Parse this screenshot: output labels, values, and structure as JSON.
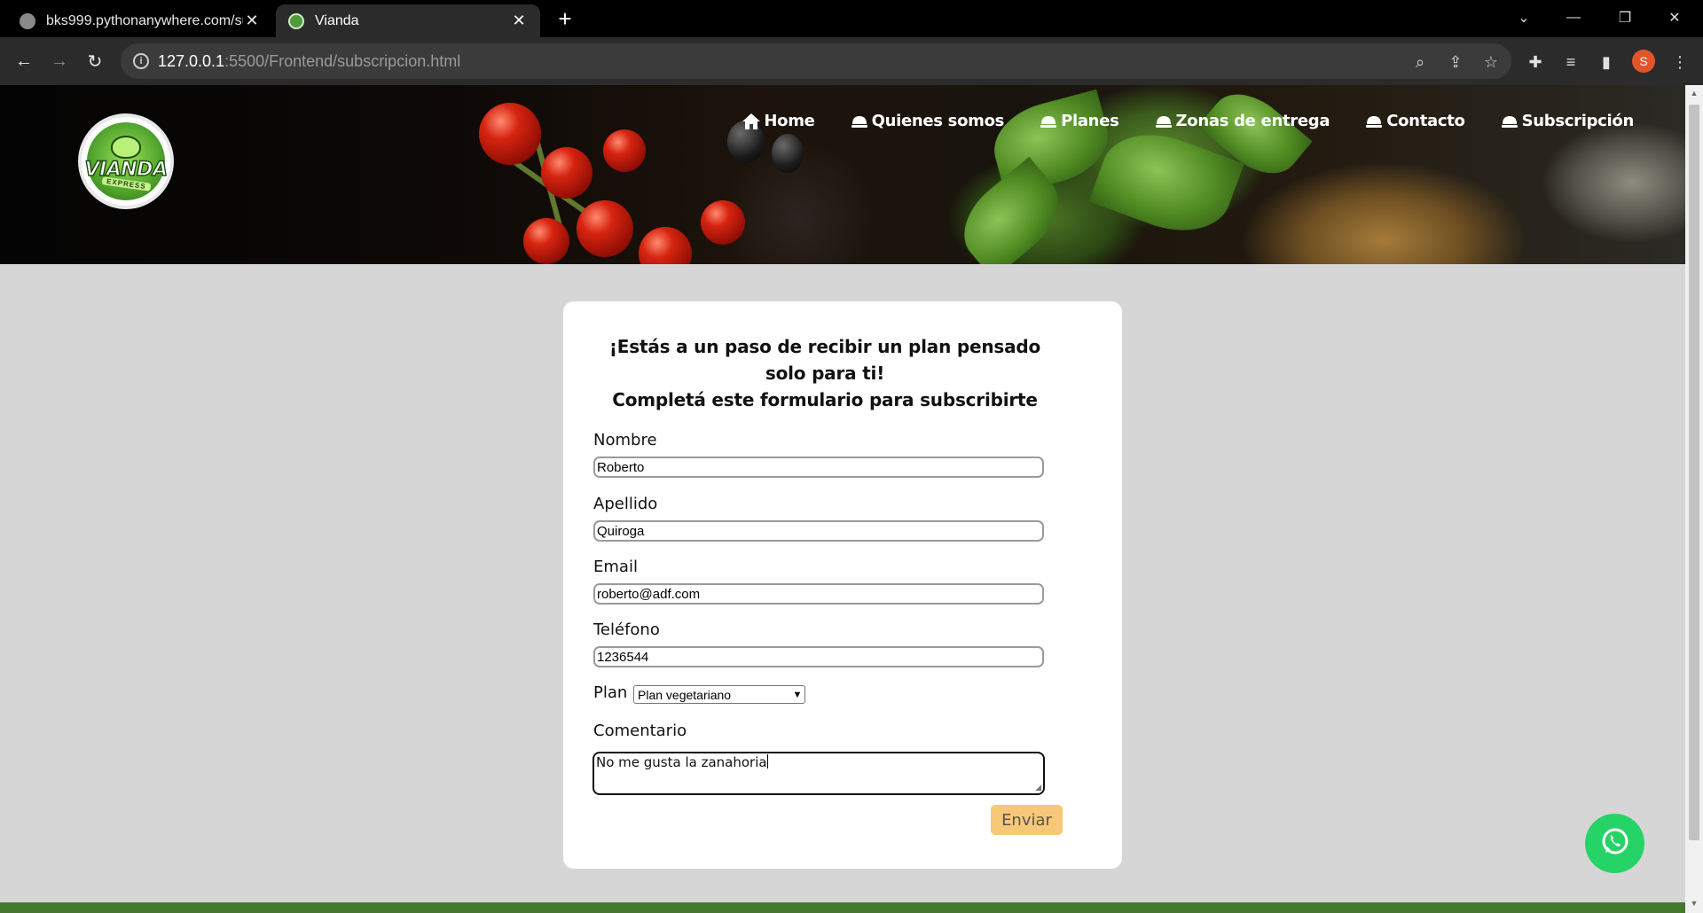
{
  "browser": {
    "tabs": [
      {
        "title": "bks999.pythonanywhere.com/su",
        "active": false
      },
      {
        "title": "Vianda",
        "active": true
      }
    ],
    "url_host": "127.0.0.1",
    "url_rest": ":5500/Frontend/subscripcion.html",
    "profile_initial": "S"
  },
  "site": {
    "logo_text": "VIANDA",
    "logo_sub": "EXPRESS",
    "nav": [
      {
        "label": "Home",
        "icon": "home-icon"
      },
      {
        "label": "Quienes somos",
        "icon": "cloche-icon"
      },
      {
        "label": "Planes",
        "icon": "cloche-icon"
      },
      {
        "label": "Zonas de entrega",
        "icon": "cloche-icon"
      },
      {
        "label": "Contacto",
        "icon": "cloche-icon"
      },
      {
        "label": "Subscripción",
        "icon": "cloche-icon"
      }
    ]
  },
  "form": {
    "title_line1": "¡Estás a un paso de recibir un plan pensado",
    "title_line2": "solo para ti!",
    "title_line3": "Completá este formulario para subscribirte",
    "fields": {
      "nombre": {
        "label": "Nombre",
        "value": "Roberto"
      },
      "apellido": {
        "label": "Apellido",
        "value": "Quiroga"
      },
      "email": {
        "label": "Email",
        "value": "roberto@adf.com"
      },
      "telefono": {
        "label": "Teléfono",
        "value": "1236544"
      }
    },
    "plan": {
      "label": "Plan",
      "selected": "Plan vegetariano"
    },
    "comentario": {
      "label": "Comentario",
      "value": "No me gusta la zanahoria"
    },
    "submit_label": "Enviar"
  },
  "colors": {
    "accent_button": "#f7c878",
    "whatsapp": "#25d366",
    "footer": "#45782f"
  }
}
